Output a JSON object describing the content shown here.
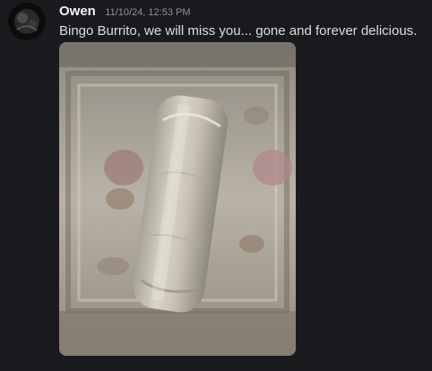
{
  "message": {
    "author": "Owen",
    "timestamp": "11/10/24, 12:53 PM",
    "text": "Bingo Burrito, we will miss you... gone and forever delicious."
  },
  "attachment": {
    "type": "image",
    "subject": "foil-wrapped burrito on a floral rug"
  },
  "icons": {
    "avatar": "user-avatar"
  },
  "colors": {
    "background": "#1a1a1e",
    "username": "#f2f3f5",
    "timestamp": "#8e9297",
    "text": "#dbdee1"
  }
}
